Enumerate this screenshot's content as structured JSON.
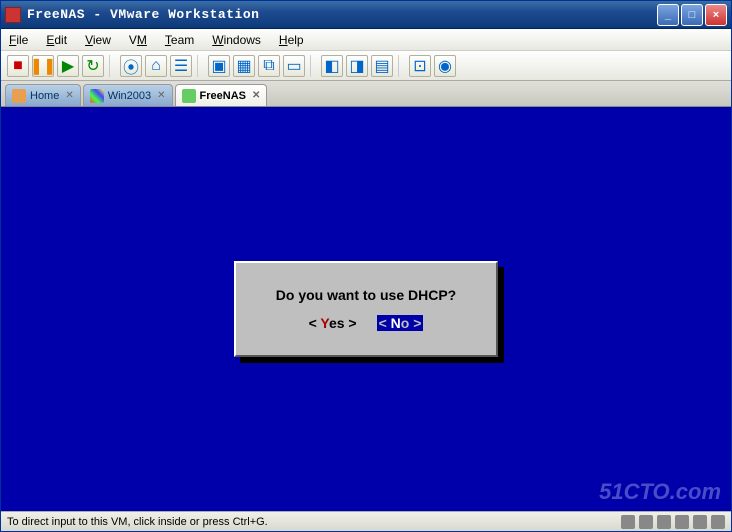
{
  "window": {
    "title": "FreeNAS - VMware Workstation"
  },
  "menu": {
    "file": "File",
    "edit": "Edit",
    "view": "View",
    "vm": "VM",
    "team": "Team",
    "windows": "Windows",
    "help": "Help"
  },
  "tabs": {
    "home": "Home",
    "win2003": "Win2003",
    "freenas": "FreeNAS"
  },
  "dialog": {
    "question": "Do you want to use DHCP?",
    "yes_open": "< ",
    "yes_hot": "Y",
    "yes_rest": "es >",
    "no_open": "< ",
    "no_hot": "N",
    "no_rest": "o   >"
  },
  "statusbar": {
    "hint": "To direct input to this VM, click inside or press Ctrl+G."
  },
  "watermark": "51CTO.com"
}
